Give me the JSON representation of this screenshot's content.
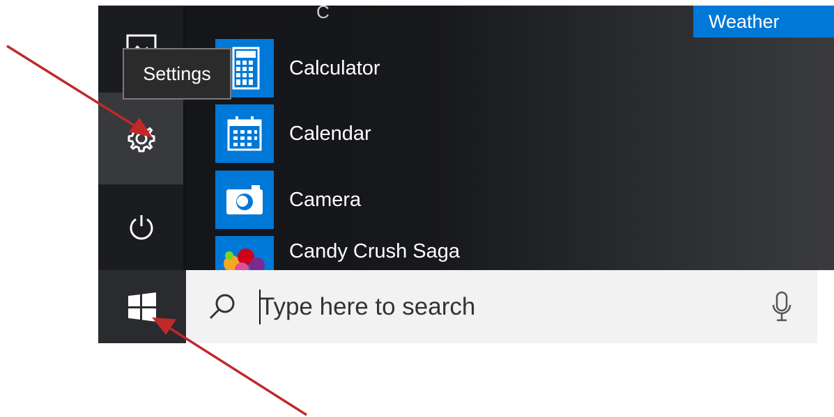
{
  "start_menu": {
    "tooltip": "Settings",
    "section_letter": "C",
    "apps": [
      {
        "label": "Calculator",
        "icon": "calculator-icon"
      },
      {
        "label": "Calendar",
        "icon": "calendar-icon"
      },
      {
        "label": "Camera",
        "icon": "camera-icon"
      },
      {
        "label": "Candy Crush Saga",
        "icon": "candy-crush-icon"
      }
    ],
    "live_tile": {
      "label": "Weather"
    },
    "rail": {
      "items": [
        "pictures-icon",
        "settings-gear-icon",
        "power-icon"
      ]
    }
  },
  "taskbar": {
    "start_icon": "windows-logo-icon",
    "search": {
      "placeholder": "Type here to search",
      "value": ""
    },
    "mic_icon": "microphone-icon"
  },
  "annotations": {
    "arrow_color": "#c0282a"
  },
  "colors": {
    "accent": "#0078d7",
    "menu_background": "#17181b",
    "rail_highlight": "#38393c"
  }
}
